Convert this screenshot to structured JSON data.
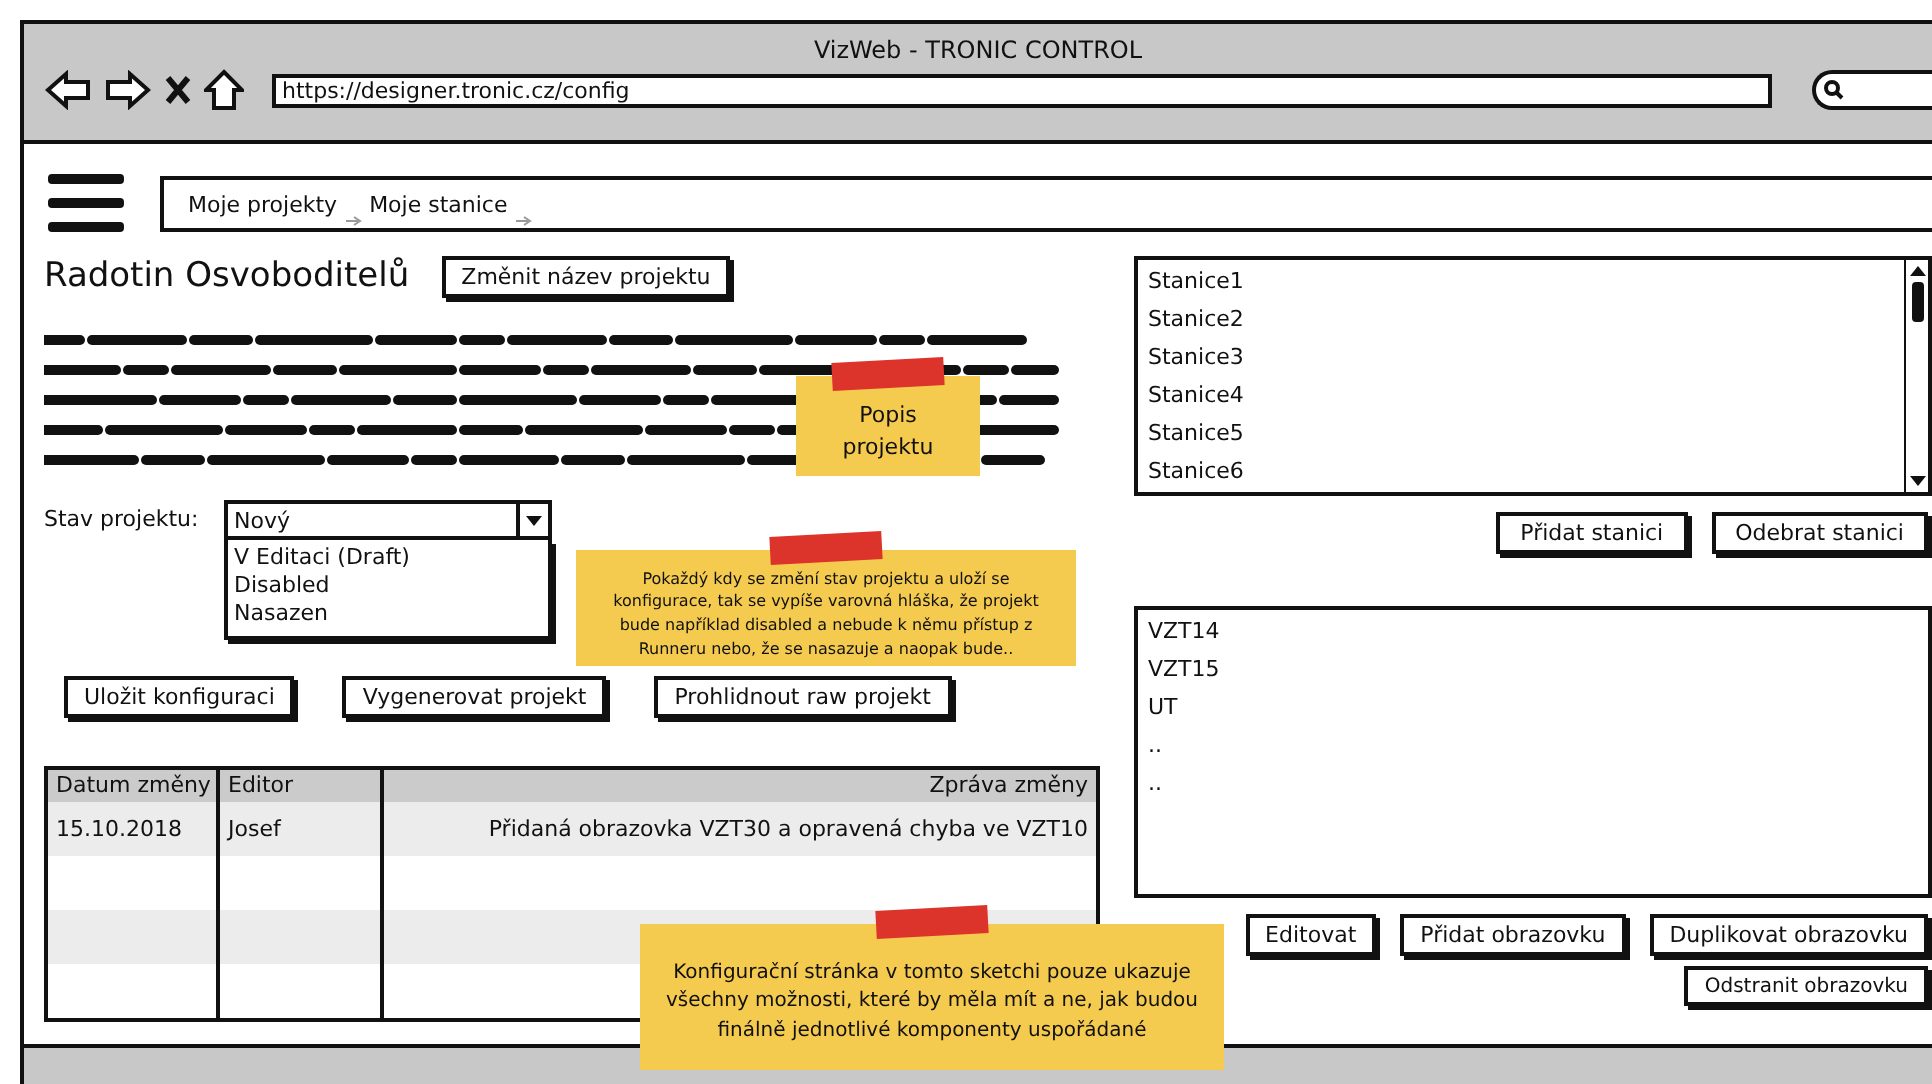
{
  "window": {
    "title": "VizWeb - TRONIC CONTROL",
    "url": "https://designer.tronic.cz/config"
  },
  "nav": {
    "links": [
      {
        "label": "Moje projekty"
      },
      {
        "label": "Moje stanice"
      }
    ]
  },
  "project": {
    "title": "Radotin Osvoboditelů",
    "rename_button": "Změnit název projektu"
  },
  "status": {
    "label": "Stav projektu:",
    "value": "Nový",
    "expanded": true,
    "options": [
      "V Editaci (Draft)",
      "Disabled",
      "Nasazen"
    ]
  },
  "actions": [
    "Uložit konfiguraci",
    "Vygenerovat projekt",
    "Prohlidnout raw projekt"
  ],
  "table": {
    "columns": [
      "Datum změny",
      "Editor",
      "Zpráva změny"
    ],
    "rows": [
      [
        "15.10.2018",
        "Josef",
        "Přidaná obrazovka VZT30 a opravená chyba ve VZT10"
      ]
    ]
  },
  "stations": {
    "items": [
      "Stanice1",
      "Stanice2",
      "Stanice3",
      "Stanice4",
      "Stanice5",
      "Stanice6"
    ],
    "buttons": [
      "Přidat stanici",
      "Odebrat stanici"
    ]
  },
  "screens": {
    "items": [
      "VZT14",
      "VZT15",
      "UT",
      "..",
      ".."
    ],
    "buttons": [
      "Editovat",
      "Přidat obrazovku",
      "Duplikovat obrazovku"
    ],
    "extra_button": "Odstranit obrazovku"
  },
  "notes": [
    {
      "text": "Popis projektu"
    },
    {
      "text": "Pokaždý kdy se změní stav projektu a uloží se konfigurace, tak se vypíše varovná hláška, že projekt bude například disabled a nebude k němu přístup z Runneru nebo, že se nasazuje a naopak bude.."
    },
    {
      "text": "Konfigurační stránka v tomto sketchi pouze ukazuje všechny možnosti, které by měla mít a ne, jak budou finálně jednotlivé komponenty uspořádané"
    }
  ]
}
